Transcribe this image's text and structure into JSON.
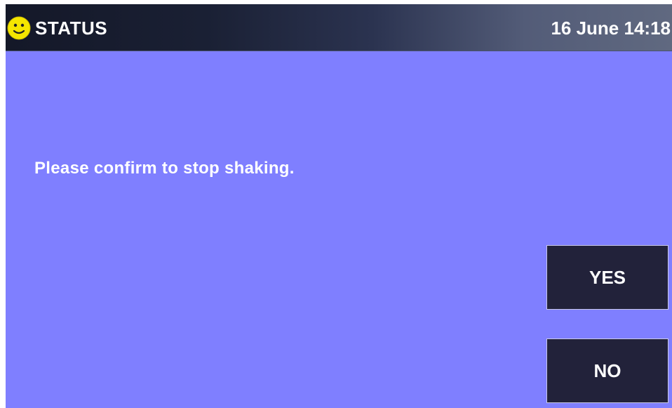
{
  "header": {
    "title": "STATUS",
    "status_icon": "smiley-face-icon",
    "datetime": "16 June 14:18"
  },
  "dialog": {
    "message": "Please confirm to stop shaking.",
    "yes_label": "YES",
    "no_label": "NO"
  },
  "colors": {
    "background": "#7f7fff",
    "button_background": "#22223a",
    "icon_yellow": "#f5e600",
    "text": "#ffffff"
  }
}
